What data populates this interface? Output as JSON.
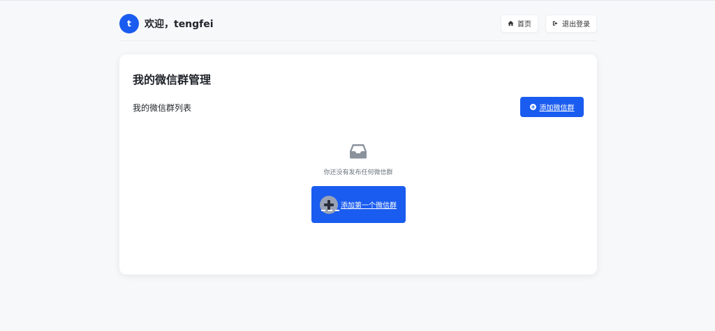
{
  "header": {
    "avatar_letter": "t",
    "welcome": "欢迎，tengfei",
    "home_label": "首页",
    "logout_label": "退出登录"
  },
  "card": {
    "title": "我的微信群管理",
    "list_title": "我的微信群列表",
    "add_label": "添加微信群"
  },
  "empty": {
    "icon": "inbox-icon",
    "message": "你还没有发布任何微信群",
    "first_label": "添加第一个微信群"
  },
  "colors": {
    "primary": "#1a5cf0",
    "background": "#f7f8fa"
  }
}
